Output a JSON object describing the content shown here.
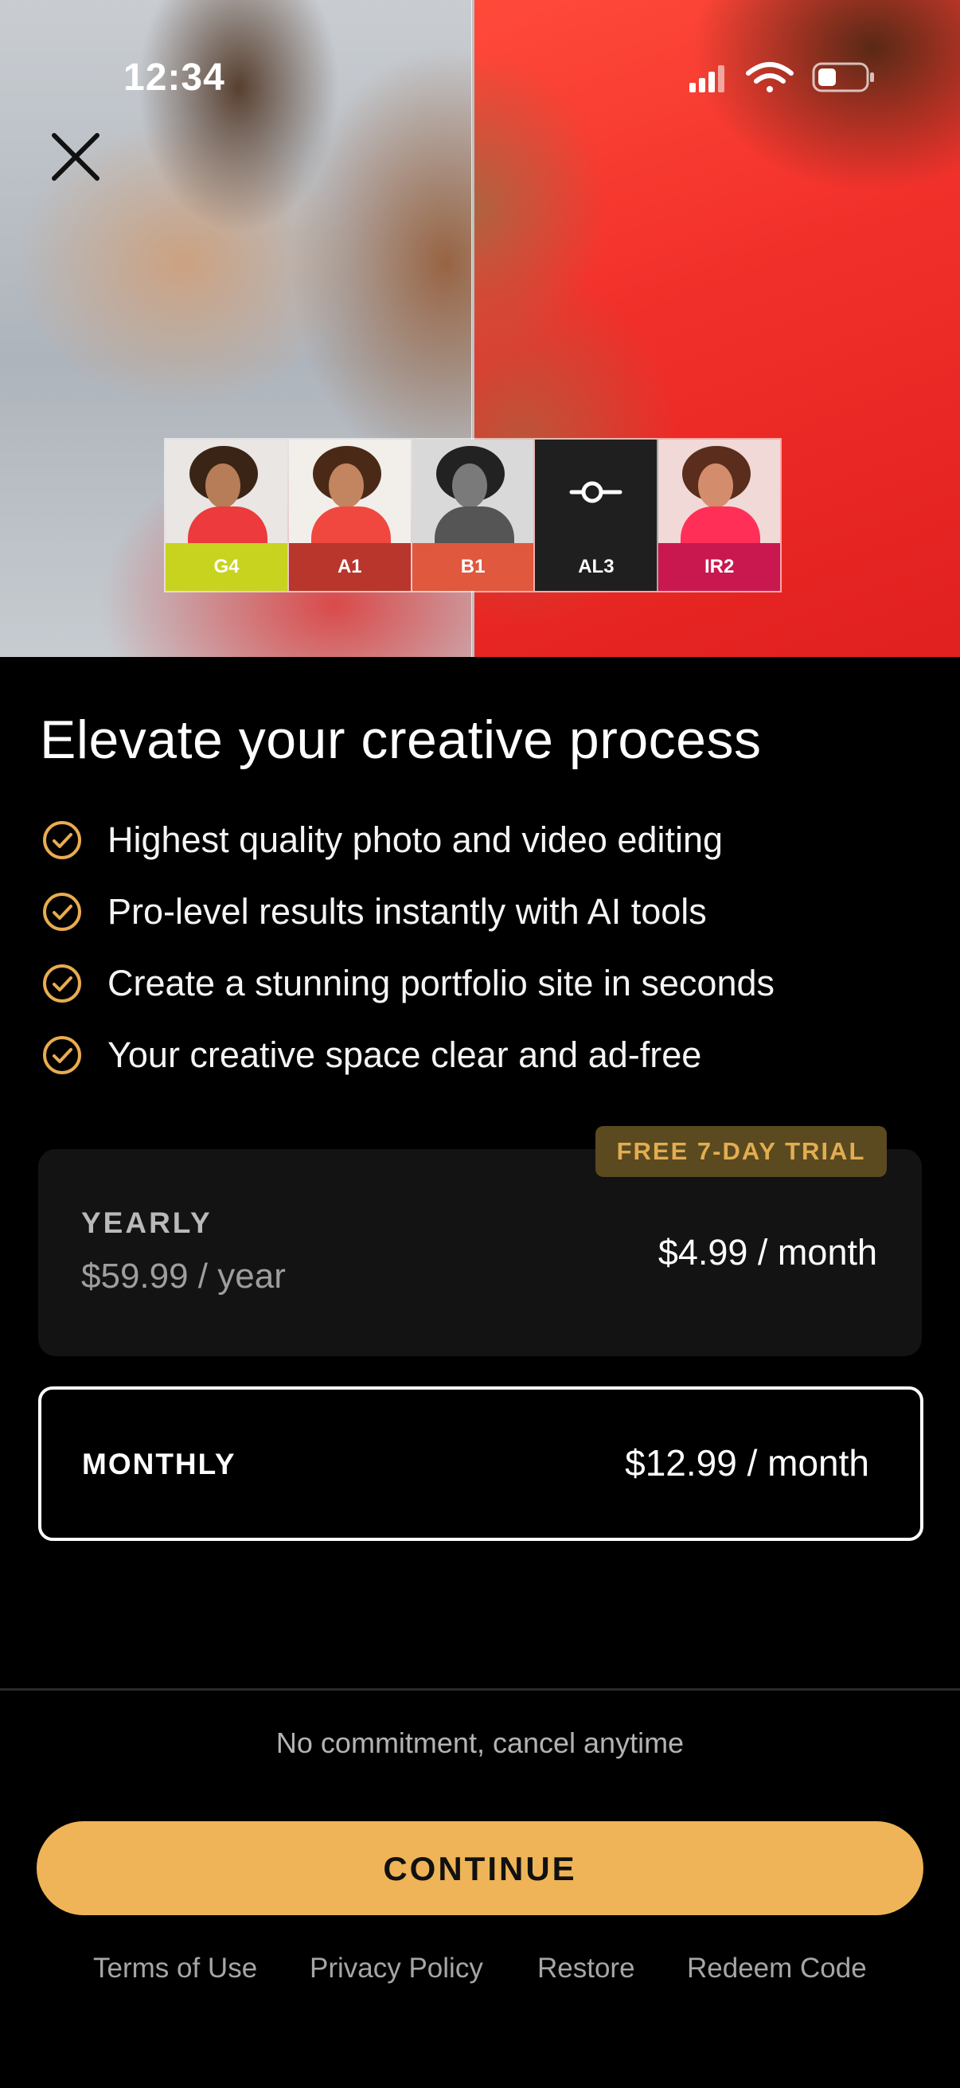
{
  "status_bar": {
    "time": "12:34"
  },
  "presets": [
    {
      "label": "G4",
      "color": "#c8d31f"
    },
    {
      "label": "A1",
      "color": "#b8362c"
    },
    {
      "label": "B1",
      "color": "#e0583e"
    },
    {
      "label": "AL3",
      "color": "#1f1f1f"
    },
    {
      "label": "IR2",
      "color": "#c9184f"
    }
  ],
  "headline": "Elevate your creative process",
  "features": [
    "Highest quality photo and video editing",
    "Pro-level results instantly with AI tools",
    "Create a stunning portfolio site in seconds",
    "Your creative space clear and ad-free"
  ],
  "plans": {
    "yearly": {
      "badge": "FREE 7-DAY TRIAL",
      "title": "YEARLY",
      "subtitle": "$59.99 / year",
      "price": "$4.99 / month",
      "selected": false
    },
    "monthly": {
      "title": "MONTHLY",
      "price": "$12.99 / month",
      "selected": true
    }
  },
  "commitment": "No commitment, cancel anytime",
  "continue_label": "CONTINUE",
  "footer": {
    "terms": "Terms of Use",
    "privacy": "Privacy Policy",
    "restore": "Restore",
    "redeem": "Redeem Code"
  },
  "colors": {
    "accent": "#efb457",
    "check": "#e9ac4f",
    "badge_bg": "#5b4a1f",
    "background": "#000000"
  },
  "icons": {
    "close": "close-icon",
    "check": "check-circle-icon",
    "signal": "signal-icon",
    "wifi": "wifi-icon",
    "battery": "battery-icon",
    "adjust": "adjust-slider-icon"
  }
}
